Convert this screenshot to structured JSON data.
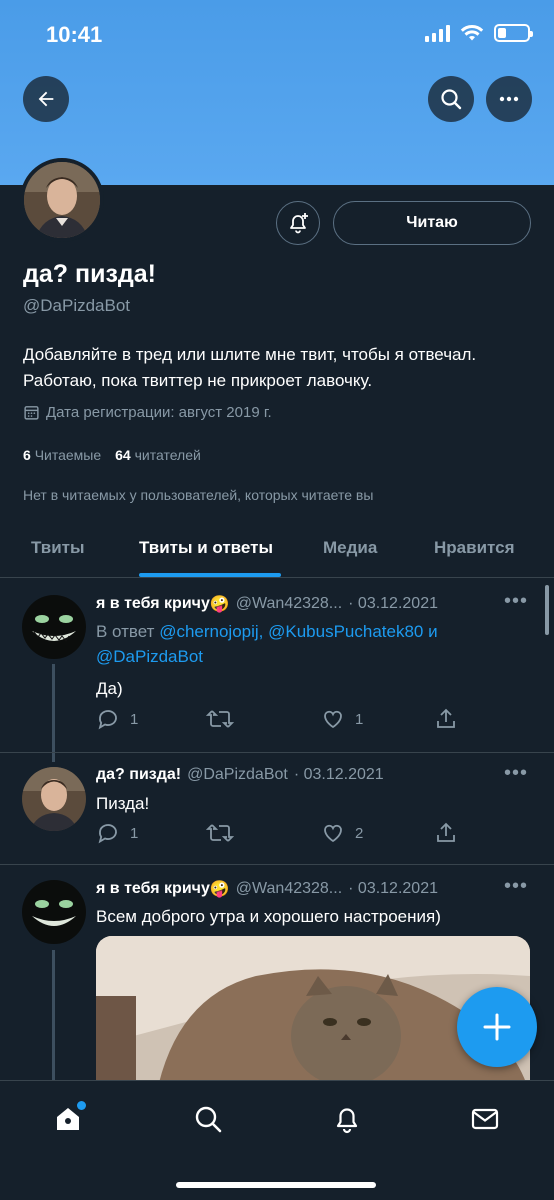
{
  "status": {
    "time": "10:41"
  },
  "profile": {
    "display_name": "да? пизда!",
    "handle": "@DaPizdaBot",
    "bio": "Добавляйте в тред или шлите мне твит, чтобы я отвечал. Работаю, пока твиттер не прикроет лавочку.",
    "joined": "Дата регистрации: август 2019 г.",
    "following_count": "6",
    "following_label": "Читаемые",
    "followers_count": "64",
    "followers_label": "читателей",
    "no_followers_you_know": "Нет в читаемых у пользователей, которых читаете вы",
    "follow_button": "Читаю"
  },
  "tabs": [
    {
      "label": "Твиты"
    },
    {
      "label": "Твиты и ответы"
    },
    {
      "label": "Медиа"
    },
    {
      "label": "Нравится"
    }
  ],
  "tweets": [
    {
      "name": "я в тебя кричу",
      "emoji": "🤪",
      "handle": "@Wan42328...",
      "date": "· 03.12.2021",
      "reply_prefix": "В ответ",
      "reply_to_1": "@chernojopij,",
      "reply_to_2": "@KubusPuchatek80",
      "reply_and": "и",
      "reply_to_3": "@DaPizdaBot",
      "text": "Да)",
      "replies": "1",
      "retweets": "",
      "likes": "1"
    },
    {
      "name": "да? пизда!",
      "handle": "@DaPizdaBot",
      "date": "· 03.12.2021",
      "text": "Пизда!",
      "replies": "1",
      "retweets": "",
      "likes": "2"
    },
    {
      "name": "я в тебя кричу",
      "emoji": "🤪",
      "handle": "@Wan42328...",
      "date": "· 03.12.2021",
      "text": "Всем доброго утра и хорошего настроения)"
    }
  ],
  "colors": {
    "accent": "#1d9bf0",
    "background": "#15202b",
    "muted": "#8899a6",
    "banner": "#4a9ce8"
  }
}
